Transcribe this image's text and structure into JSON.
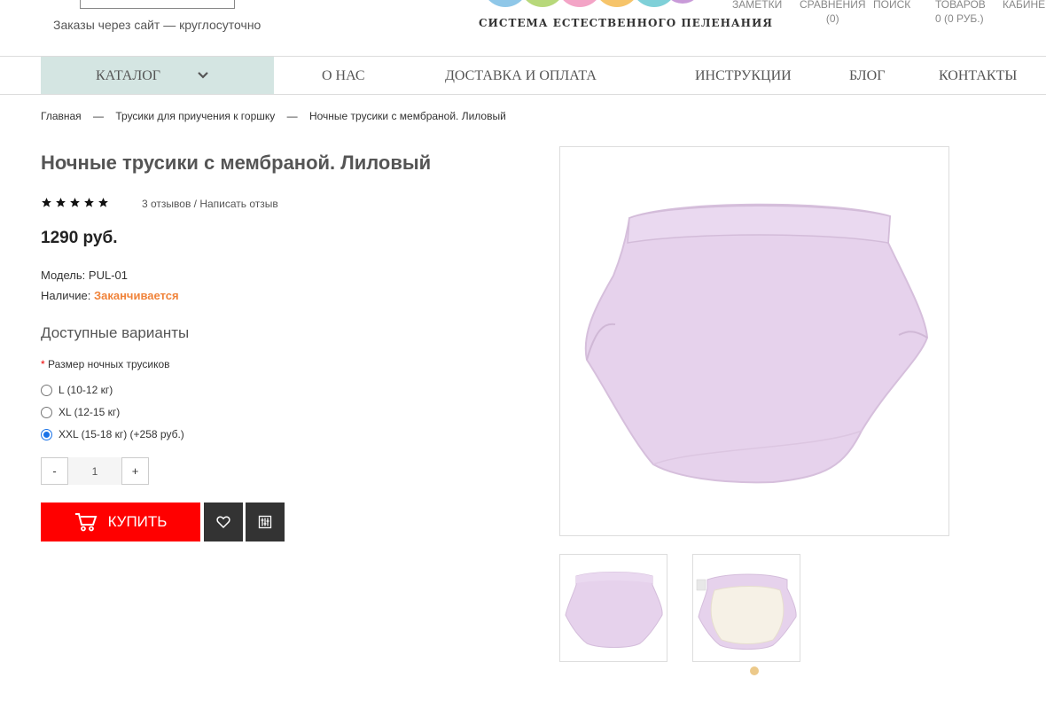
{
  "header": {
    "orders_note": "Заказы через сайт — круглосуточно",
    "logo_caption": "СИСТЕМА ЕСТЕСТВЕННОГО ПЕЛЕНАНИЯ",
    "links": [
      {
        "label": "ЗАМЕТКИ",
        "sub": ""
      },
      {
        "label": "СРАВНЕНИЯ",
        "sub": "(0)"
      },
      {
        "label": "ПОИСК",
        "sub": ""
      },
      {
        "label": "ТОВАРОВ",
        "sub": "0 (0 РУБ.)"
      },
      {
        "label": "КАБИНЕ",
        "sub": ""
      }
    ]
  },
  "nav": {
    "catalog": "КАТАЛОГ",
    "items": [
      "О НАС",
      "ДОСТАВКА И ОПЛАТА",
      "ИНСТРУКЦИИ",
      "БЛОГ",
      "КОНТАКТЫ"
    ]
  },
  "breadcrumb": {
    "items": [
      "Главная",
      "Трусики для приучения к горшку",
      "Ночные трусики с мембраной. Лиловый"
    ],
    "separator": "—"
  },
  "product": {
    "title": "Ночные трусики с мембраной. Лиловый",
    "rating": 5,
    "reviews_text": "3 отзывов / Написать отзыв",
    "price": "1290 руб.",
    "model_label": "Модель:",
    "model_value": "PUL-01",
    "availability_label": "Наличие:",
    "availability_value": "Заканчивается",
    "variants_title": "Доступные варианты",
    "option_required_mark": "*",
    "option_label": "Размер ночных трусиков",
    "options": [
      {
        "label": "L (10-12 кг)",
        "checked": false
      },
      {
        "label": "XL (12-15 кг)",
        "checked": false
      },
      {
        "label": "XXL (15-18 кг) (+258 руб.)",
        "checked": true
      }
    ],
    "quantity": {
      "minus": "-",
      "value": "1",
      "plus": "+"
    },
    "buy_label": "КУПИТЬ",
    "colors": {
      "buy": "#ff0000",
      "status": "#f0833a",
      "nav_catalog_bg": "#d4e5e2",
      "product": "#e7d2ec"
    }
  },
  "icons": [
    "chevron-down-icon",
    "star-icon",
    "cart-icon",
    "heart-icon",
    "compare-icon"
  ]
}
